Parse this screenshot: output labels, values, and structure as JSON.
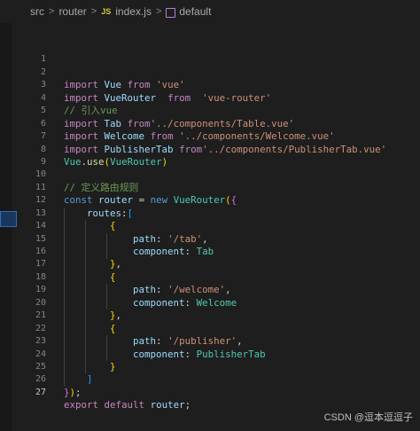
{
  "breadcrumb": {
    "items": [
      "src",
      "router",
      "index.js",
      "default"
    ]
  },
  "editor": {
    "lines": [
      {
        "n": "1",
        "code": ""
      },
      {
        "n": "2",
        "code": "import Vue from 'vue'"
      },
      {
        "n": "3",
        "code": "import VueRouter  from  'vue-router'"
      },
      {
        "n": "4",
        "code": "// 引入vue"
      },
      {
        "n": "5",
        "code": "import Tab from'../components/Table.vue'"
      },
      {
        "n": "6",
        "code": "import Welcome from '../components/Welcome.vue'"
      },
      {
        "n": "7",
        "code": "import PublisherTab from'../components/PublisherTab.vue'"
      },
      {
        "n": "8",
        "code": "Vue.use(VueRouter)"
      },
      {
        "n": "9",
        "code": ""
      },
      {
        "n": "10",
        "code": "// 定义路由规则"
      },
      {
        "n": "11",
        "code": "const router = new VueRouter({"
      },
      {
        "n": "12",
        "code": "    routes:["
      },
      {
        "n": "13",
        "code": "        {"
      },
      {
        "n": "14",
        "code": "            path: '/tab',"
      },
      {
        "n": "15",
        "code": "            component: Tab"
      },
      {
        "n": "16",
        "code": "        },"
      },
      {
        "n": "17",
        "code": "        {"
      },
      {
        "n": "18",
        "code": "            path: '/welcome',"
      },
      {
        "n": "19",
        "code": "            component: Welcome"
      },
      {
        "n": "20",
        "code": "        },"
      },
      {
        "n": "21",
        "code": "        {"
      },
      {
        "n": "22",
        "code": "            path: '/publisher',"
      },
      {
        "n": "23",
        "code": "            component: PublisherTab"
      },
      {
        "n": "24",
        "code": "        }"
      },
      {
        "n": "25",
        "code": "    ]"
      },
      {
        "n": "26",
        "code": "});"
      },
      {
        "n": "27",
        "code": "export default router;"
      }
    ]
  },
  "watermark": "CSDN @逗本逗逗子"
}
